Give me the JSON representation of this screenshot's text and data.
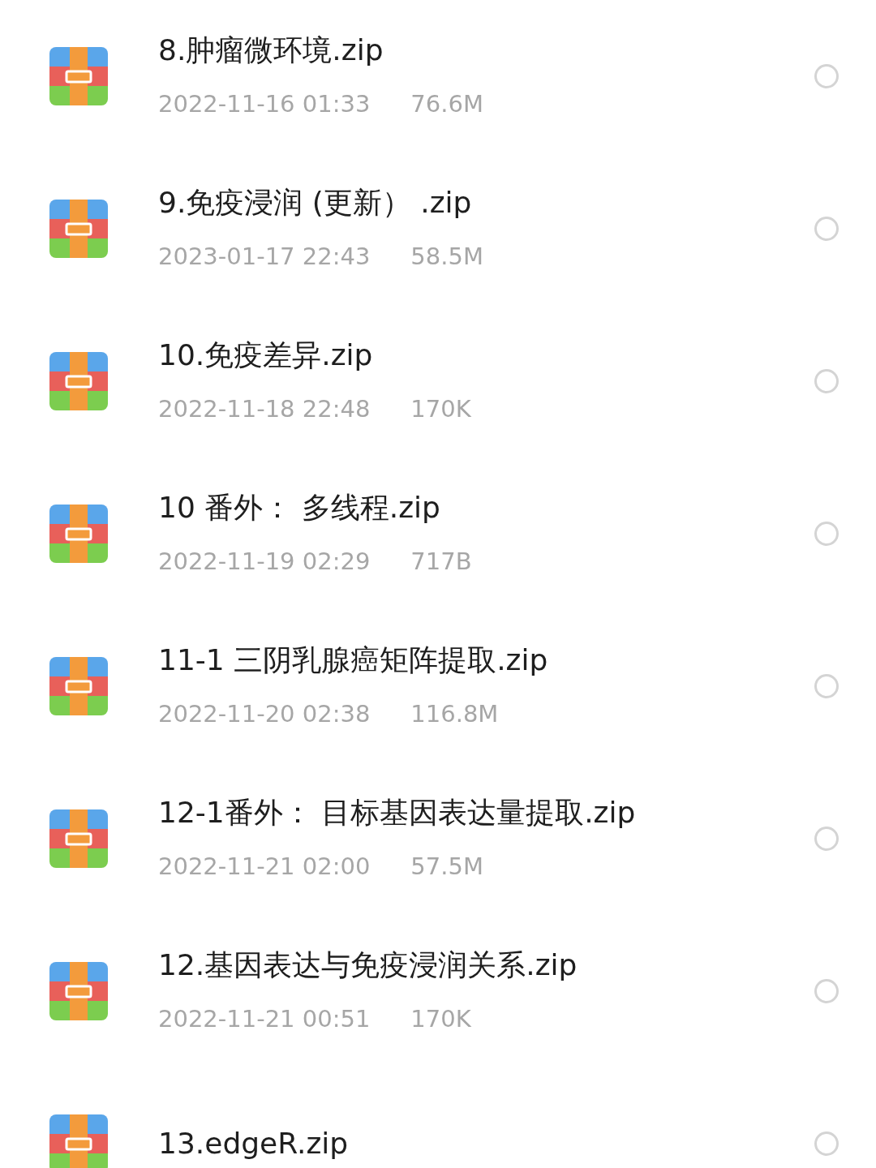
{
  "files": [
    {
      "name": "8.肿瘤微环境.zip",
      "date": "2022-11-16 01:33",
      "size": "76.6M",
      "selected": false
    },
    {
      "name": "9.免疫浸润 (更新） .zip",
      "date": "2023-01-17 22:43",
      "size": "58.5M",
      "selected": false
    },
    {
      "name": "10.免疫差异.zip",
      "date": "2022-11-18 22:48",
      "size": "170K",
      "selected": false
    },
    {
      "name": "10 番外： 多线程.zip",
      "date": "2022-11-19 02:29",
      "size": "717B",
      "selected": false
    },
    {
      "name": "11-1 三阴乳腺癌矩阵提取.zip",
      "date": "2022-11-20 02:38",
      "size": "116.8M",
      "selected": false
    },
    {
      "name": "12-1番外： 目标基因表达量提取.zip",
      "date": "2022-11-21 02:00",
      "size": "57.5M",
      "selected": false
    },
    {
      "name": "12.基因表达与免疫浸润关系.zip",
      "date": "2022-11-21 00:51",
      "size": "170K",
      "selected": false
    },
    {
      "name": "13.edgeR.zip",
      "selected": false
    }
  ]
}
